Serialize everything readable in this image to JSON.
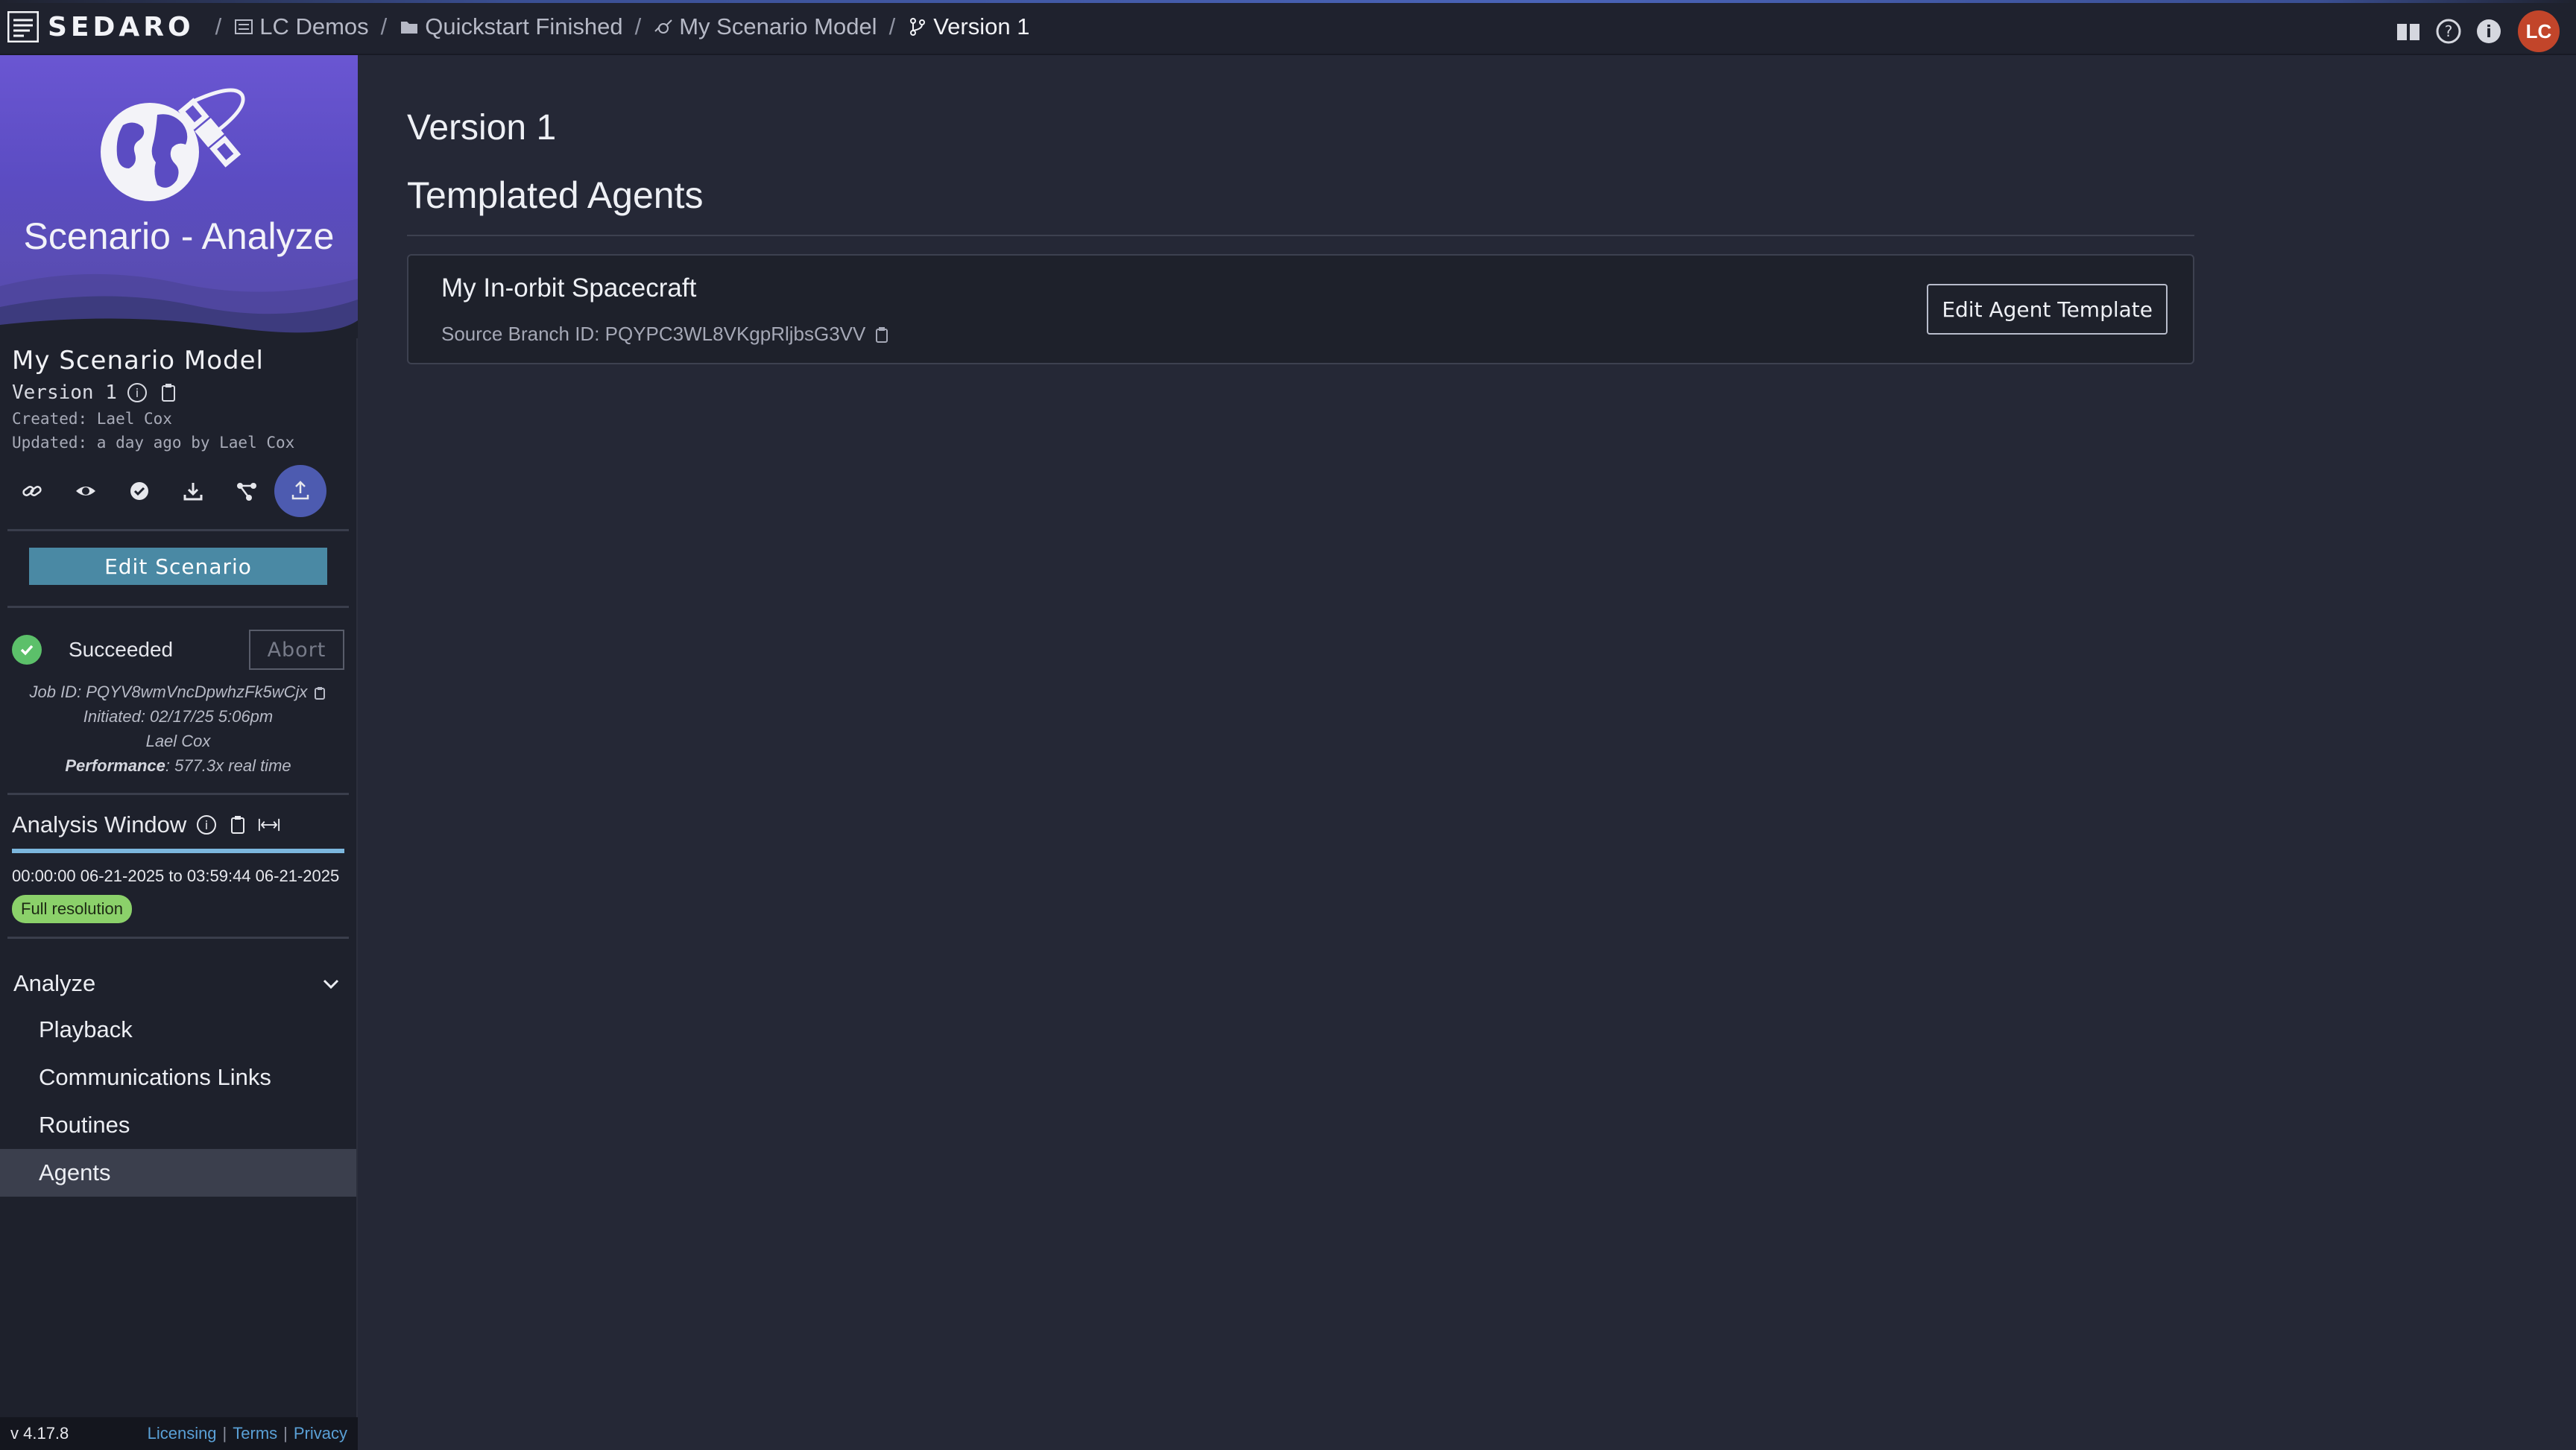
{
  "app": {
    "name": "SEDARO"
  },
  "breadcrumbs": [
    {
      "label": "LC Demos",
      "icon": "workspace-icon"
    },
    {
      "label": "Quickstart Finished",
      "icon": "folder-icon"
    },
    {
      "label": "My Scenario Model",
      "icon": "satellite-icon"
    },
    {
      "label": "Version 1",
      "icon": "branch-icon"
    }
  ],
  "user": {
    "initials": "LC",
    "avatar_color": "#c2452a"
  },
  "sidebar": {
    "hero_title": "Scenario - Analyze",
    "model_name": "My Scenario Model",
    "version_label": "Version 1",
    "created": "Created: Lael Cox",
    "updated": "Updated: a day ago by Lael Cox",
    "edit_scenario_label": "Edit Scenario",
    "status": "Succeeded",
    "abort_label": "Abort",
    "job_id": "Job ID: PQYV8wmVncDpwhzFk5wCjx",
    "initiated": "Initiated: 02/17/25 5:06pm",
    "initiated_by": "Lael Cox",
    "performance_label": "Performance",
    "performance_value": ": 577.3x real time",
    "analysis_window": {
      "title": "Analysis Window",
      "start": "00:00:00 06-21-2025",
      "to": "to",
      "end": "03:59:44 06-21-2025",
      "resolution": "Full resolution"
    },
    "nav": {
      "header": "Analyze",
      "items": [
        {
          "label": "Playback",
          "active": false
        },
        {
          "label": "Communications Links",
          "active": false
        },
        {
          "label": "Routines",
          "active": false
        },
        {
          "label": "Agents",
          "active": true
        }
      ]
    },
    "footer": {
      "version": "v 4.17.8",
      "licensing": "Licensing",
      "terms": "Terms",
      "privacy": "Privacy",
      "sep": "|"
    }
  },
  "main": {
    "page_title": "Version 1",
    "section_title": "Templated Agents",
    "agents": [
      {
        "name": "My In-orbit Spacecraft",
        "source_branch": "Source Branch ID: PQYPC3WL8VKgpRljbsG3VV",
        "edit_label": "Edit Agent Template"
      }
    ]
  },
  "colors": {
    "accent": "#4a89a4",
    "success": "#5cc06a",
    "badge": "#8bd16a",
    "hero": "#6a56d2"
  }
}
